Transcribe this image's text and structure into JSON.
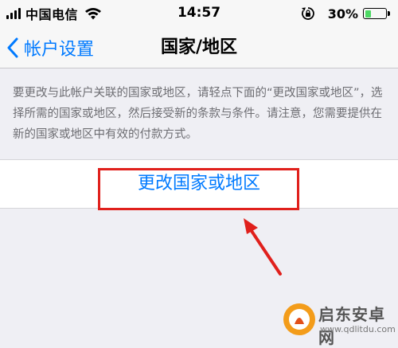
{
  "status_bar": {
    "carrier": "中国电信",
    "time": "14:57",
    "battery_percent": "30%",
    "battery_level": 0.3
  },
  "nav": {
    "back_label": "帐户设置",
    "title": "国家/地区"
  },
  "info_text": "要更改与此帐户关联的国家或地区，请轻点下面的“更改国家或地区”，选择所需的国家或地区，然后接受新的条款与条件。请注意，您需要提供在新的国家或地区中有效的付款方式。",
  "change_region_button": "更改国家或地区",
  "watermark": {
    "name": "启东安卓网",
    "url": "www.qdlitdu.com"
  },
  "colors": {
    "accent": "#007aff",
    "annotation": "#e0201c",
    "battery": "#4cd964"
  },
  "icons": [
    "signal-icon",
    "wifi-icon",
    "rotation-lock-icon",
    "battery-icon",
    "chevron-left-icon",
    "annotation-arrow-icon"
  ]
}
